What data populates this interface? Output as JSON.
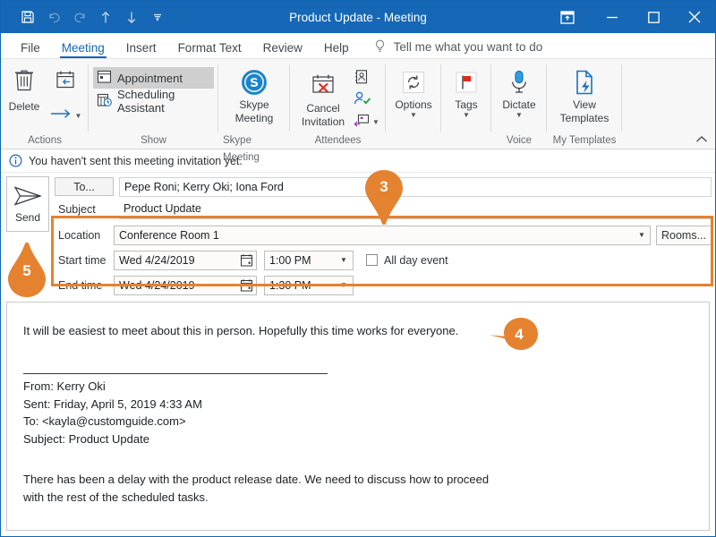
{
  "window": {
    "title": "Product Update - Meeting",
    "quick_access": [
      {
        "name": "save-icon",
        "label": "Save",
        "state": "enabled"
      },
      {
        "name": "undo-icon",
        "label": "Undo",
        "state": "disabled"
      },
      {
        "name": "redo-icon",
        "label": "Redo",
        "state": "disabled"
      },
      {
        "name": "previous-item-icon",
        "label": "Previous Item",
        "state": "enabled"
      },
      {
        "name": "next-item-icon",
        "label": "Next Item",
        "state": "enabled"
      },
      {
        "name": "customize-quick-access-icon",
        "label": "Customize Quick Access Toolbar",
        "state": "enabled"
      }
    ],
    "controls": [
      {
        "name": "ribbon-display-options-icon",
        "label": "Ribbon Display Options"
      },
      {
        "name": "minimize-icon",
        "label": "Minimize"
      },
      {
        "name": "maximize-icon",
        "label": "Maximize"
      },
      {
        "name": "close-icon",
        "label": "Close"
      }
    ],
    "accent_color": "#1667b5",
    "callout_color": "#e58230"
  },
  "tabs": [
    {
      "label": "File",
      "active": false
    },
    {
      "label": "Meeting",
      "active": true
    },
    {
      "label": "Insert",
      "active": false
    },
    {
      "label": "Format Text",
      "active": false
    },
    {
      "label": "Review",
      "active": false
    },
    {
      "label": "Help",
      "active": false
    }
  ],
  "tell_me": {
    "placeholder": "Tell me what you want to do",
    "icon": "lightbulb-icon"
  },
  "ribbon": {
    "groups": [
      {
        "label": "Actions",
        "items": [
          {
            "label": "Delete",
            "icon": "trash-icon"
          },
          {
            "label": "Forward",
            "icon": "calendar-forward-icon"
          },
          {
            "label": "Forward Arrow",
            "icon": "arrow-right-icon"
          }
        ]
      },
      {
        "label": "Show",
        "items": [
          {
            "label": "Appointment",
            "icon": "appointment-icon",
            "selected": true
          },
          {
            "label": "Scheduling Assistant",
            "icon": "scheduling-assistant-icon",
            "selected": false
          }
        ]
      },
      {
        "label": "Skype Meeting",
        "items": [
          {
            "label": "Skype\nMeeting",
            "label_line1": "Skype",
            "label_line2": "Meeting",
            "icon": "skype-icon"
          }
        ]
      },
      {
        "label": "Attendees",
        "items": [
          {
            "label_line1": "Cancel",
            "label_line2": "Invitation",
            "icon": "cancel-invitation-icon"
          },
          {
            "label": "Address Book",
            "icon": "address-book-icon"
          },
          {
            "label": "Check Names",
            "icon": "check-names-icon"
          },
          {
            "label": "Response Options",
            "icon": "response-options-icon"
          }
        ]
      },
      {
        "label": "",
        "items": [
          {
            "label": "Options",
            "icon": "options-refresh-icon",
            "has_dropdown": true
          }
        ]
      },
      {
        "label": "",
        "items": [
          {
            "label": "Tags",
            "icon": "flag-icon",
            "has_dropdown": true
          }
        ]
      },
      {
        "label": "Voice",
        "items": [
          {
            "label": "Dictate",
            "icon": "microphone-icon",
            "has_dropdown": true
          }
        ]
      },
      {
        "label": "My Templates",
        "items": [
          {
            "label_line1": "View",
            "label_line2": "Templates",
            "icon": "view-templates-icon"
          }
        ]
      }
    ],
    "collapse_label": "Collapse the Ribbon"
  },
  "info_bar": {
    "icon": "info-icon",
    "message": "You haven't sent this meeting invitation yet."
  },
  "header": {
    "send_button": {
      "label": "Send",
      "icon": "send-arrow-icon"
    },
    "to": {
      "button_label": "To...",
      "value": "Pepe Roni; Kerry Oki; Iona Ford"
    },
    "subject": {
      "label": "Subject",
      "value": "Product Update"
    },
    "location": {
      "label": "Location",
      "value": "Conference Room 1",
      "rooms_button": "Rooms..."
    },
    "start_time": {
      "label": "Start time",
      "date": "Wed 4/24/2019",
      "time": "1:00 PM"
    },
    "end_time": {
      "label": "End time",
      "date": "Wed 4/24/2019",
      "time": "1:30 PM"
    },
    "all_day_event": {
      "label": "All day event",
      "checked": false
    }
  },
  "body": {
    "message": "It will be easiest to meet about this in person. Hopefully this time works for everyone.",
    "quoted": {
      "from": "From: Kerry Oki",
      "sent": "Sent: Friday, April 5, 2019 4:33 AM",
      "to": "To: <kayla@customguide.com>",
      "subject": "Subject: Product Update",
      "line1": "There has been a delay with the product release date. We need to discuss how to proceed",
      "line2": "with the rest of the scheduled tasks."
    }
  },
  "callouts": [
    {
      "number": "3",
      "direction": "down"
    },
    {
      "number": "4",
      "direction": "left"
    },
    {
      "number": "5",
      "direction": "up"
    }
  ]
}
